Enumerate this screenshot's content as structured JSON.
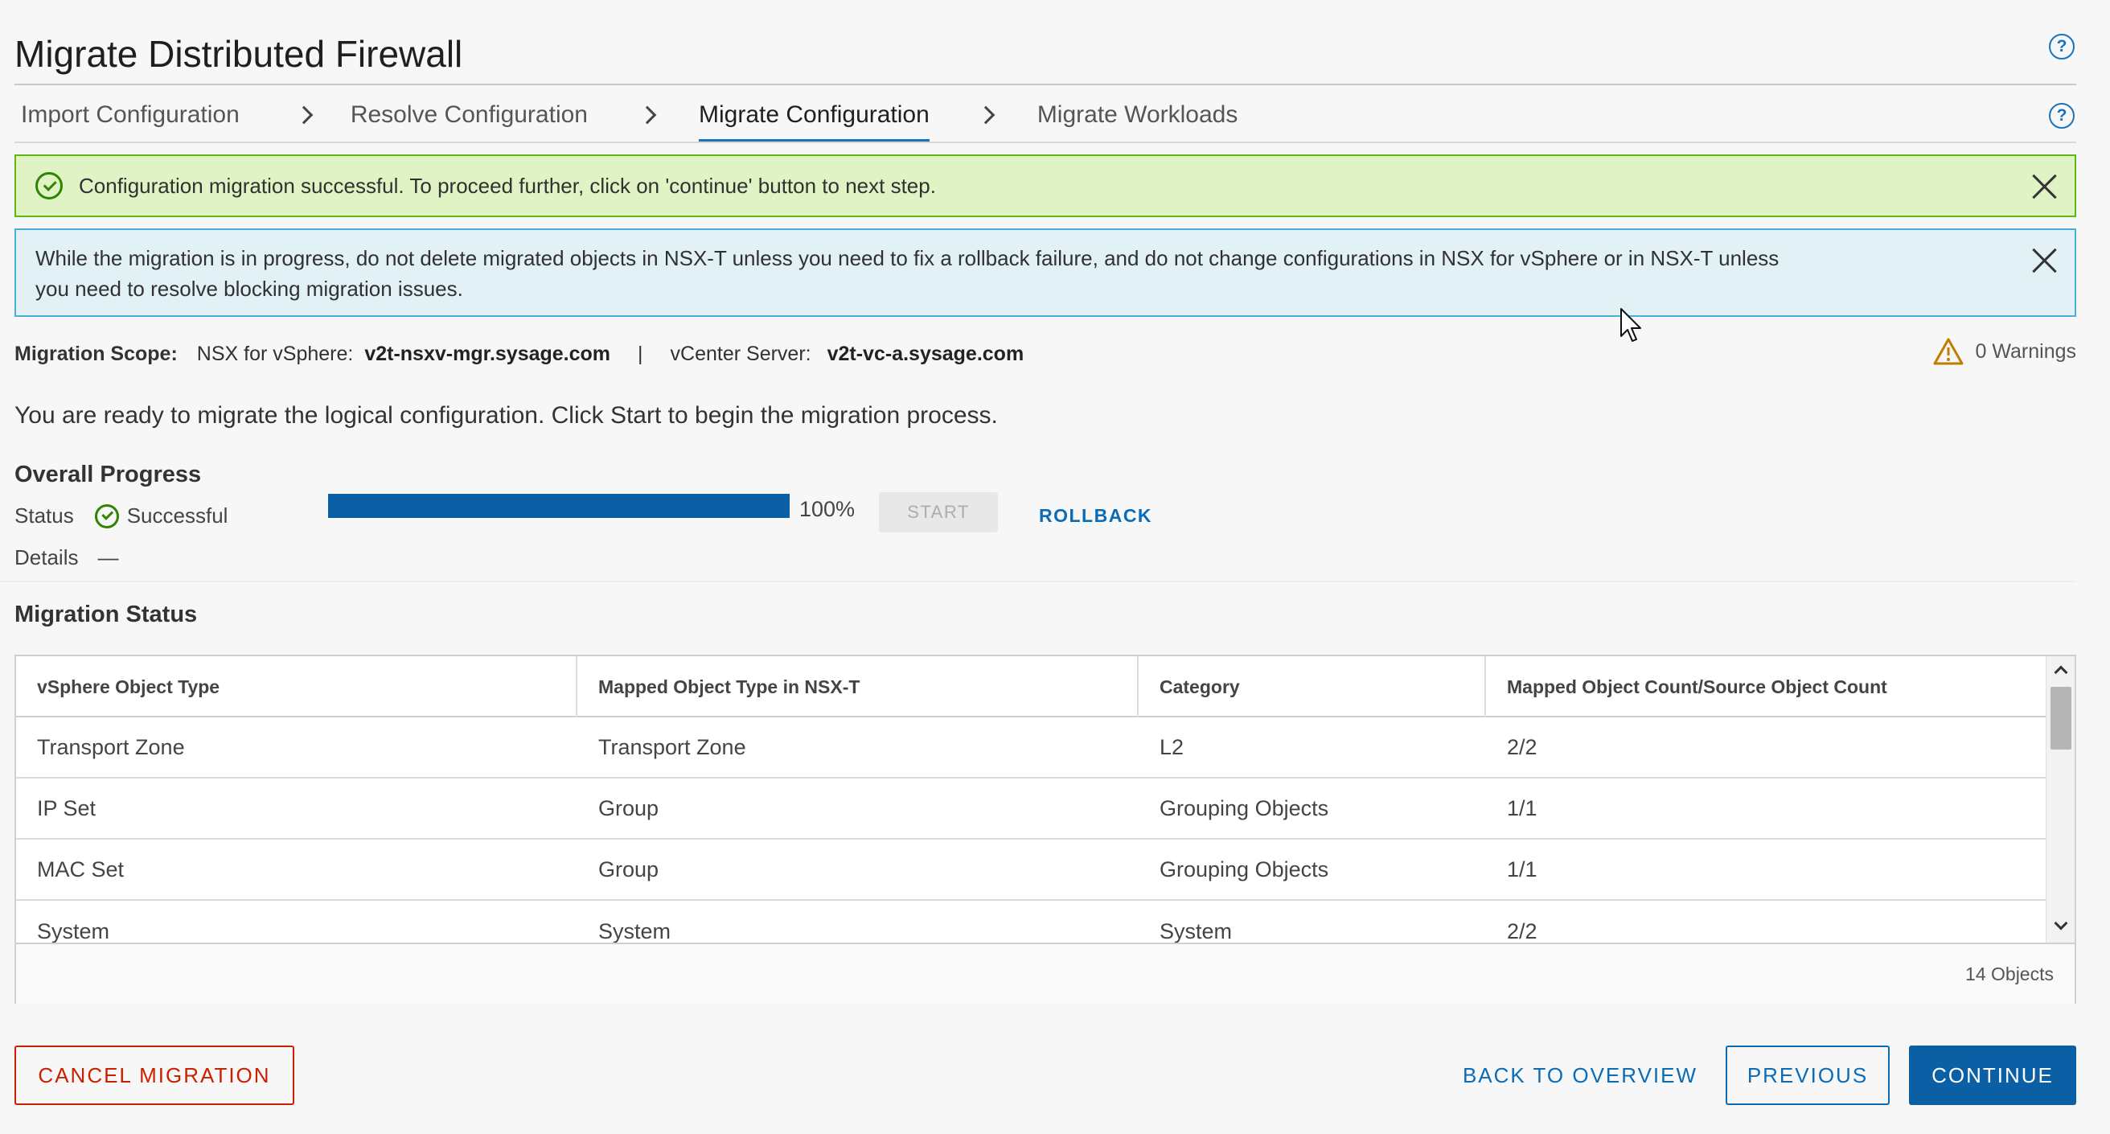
{
  "page": {
    "title": "Migrate Distributed Firewall"
  },
  "steps": [
    {
      "label": "Import Configuration"
    },
    {
      "label": "Resolve Configuration"
    },
    {
      "label": "Migrate Configuration"
    },
    {
      "label": "Migrate Workloads"
    }
  ],
  "alerts": {
    "success": "Configuration migration successful. To proceed further, click on 'continue' button to next step.",
    "info_line1": "While the migration is in progress, do not delete migrated objects in NSX-T unless you need to fix a rollback failure, and do not change configurations in NSX for vSphere or in NSX-T unless",
    "info_line2": "you need to resolve blocking migration issues."
  },
  "scope": {
    "label": "Migration Scope:",
    "nsx_label": "NSX for vSphere:",
    "nsx_value": "v2t-nsxv-mgr.sysage.com",
    "separator": "|",
    "vc_label": "vCenter Server:",
    "vc_value": "v2t-vc-a.sysage.com",
    "warnings": "0 Warnings"
  },
  "ready_text": "You are ready to migrate the logical configuration. Click Start to begin the migration process.",
  "overall": {
    "heading": "Overall Progress",
    "status_label": "Status",
    "status_value": "Successful",
    "details_label": "Details",
    "details_value": "—",
    "progress_percent": 100,
    "progress_text": "100%",
    "start_label": "START",
    "rollback_label": "ROLLBACK"
  },
  "migration_status": {
    "heading": "Migration Status",
    "columns": [
      "vSphere Object Type",
      "Mapped Object Type in NSX-T",
      "Category",
      "Mapped Object Count/Source Object Count"
    ],
    "rows": [
      [
        "Transport Zone",
        "Transport Zone",
        "L2",
        "2/2"
      ],
      [
        "IP Set",
        "Group",
        "Grouping Objects",
        "1/1"
      ],
      [
        "MAC Set",
        "Group",
        "Grouping Objects",
        "1/1"
      ],
      [
        "System",
        "System",
        "System",
        "2/2"
      ]
    ],
    "footer_count": "14 Objects"
  },
  "footer": {
    "cancel": "CANCEL MIGRATION",
    "back": "BACK TO OVERVIEW",
    "previous": "PREVIOUS",
    "continue": "CONTINUE"
  },
  "colors": {
    "primary": "#0b5fa5",
    "success": "#2f8400",
    "danger": "#c92100",
    "warning": "#c27b00"
  }
}
